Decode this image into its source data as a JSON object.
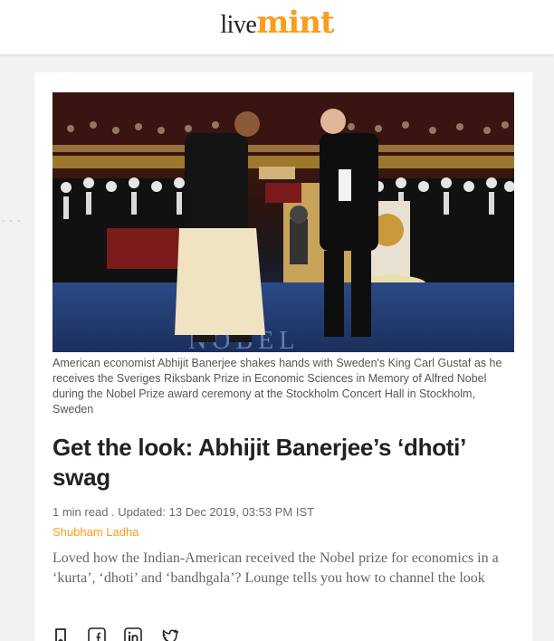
{
  "header": {
    "logo_live": "live",
    "logo_mint": "mint"
  },
  "article": {
    "image": {
      "caption": "American economist Abhijit Banerjee shakes hands with Sweden's King Carl Gustaf as he receives the Sveriges Riksbank Prize in Economic Sciences in Memory of Alfred Nobel during the Nobel Prize award ceremony at the Stockholm Concert Hall in Stockholm, Sweden"
    },
    "headline": "Get the look: Abhijit Banerjee’s ‘dhoti’ swag",
    "meta": "1 min read . Updated: 13 Dec 2019, 03:53 PM IST",
    "author": "Shubham Ladha",
    "summary": "Loved how the Indian-American received the Nobel prize for economics in a ‘kurta’, ‘dhoti’ and ‘bandhgala’? Lounge tells you how to channel the look"
  },
  "share_icons": [
    "bookmark-icon",
    "facebook-icon",
    "linkedin-icon",
    "twitter-icon"
  ],
  "colors": {
    "brand_orange": "#f99d1c",
    "headline": "#222222",
    "caption": "#555555",
    "page_background": "#f2f2f2"
  }
}
